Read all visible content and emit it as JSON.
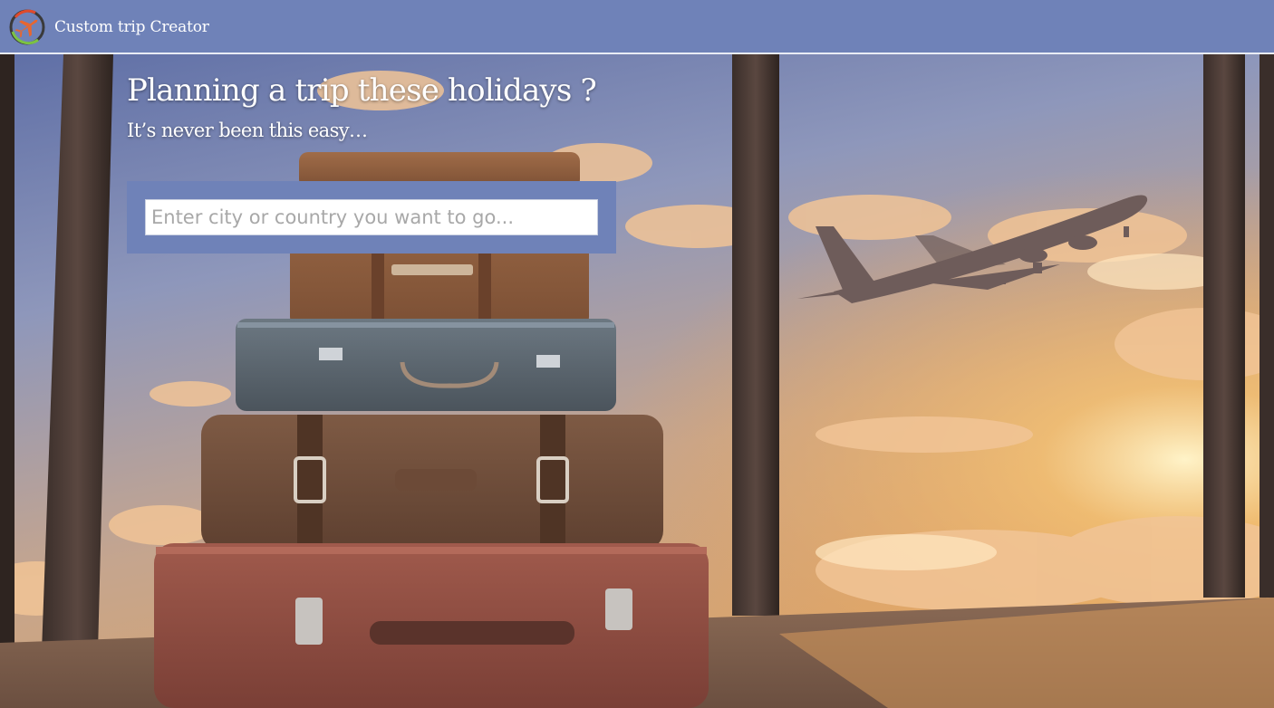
{
  "navbar": {
    "brand": "Custom trip Creator",
    "logo_icon": "airplane-compass-icon",
    "colors": {
      "bar": "#6f82b8",
      "ring_red": "#e04a2c",
      "ring_green": "#7cc243",
      "plane": "#e8662f"
    }
  },
  "hero": {
    "title": "Planning a trip these holidays ?",
    "subtitle": "It’s never been this easy…"
  },
  "search": {
    "value": "",
    "placeholder": "Enter city or country you want to go..."
  },
  "background": {
    "scene": "suitcases-and-airplane-photo"
  }
}
